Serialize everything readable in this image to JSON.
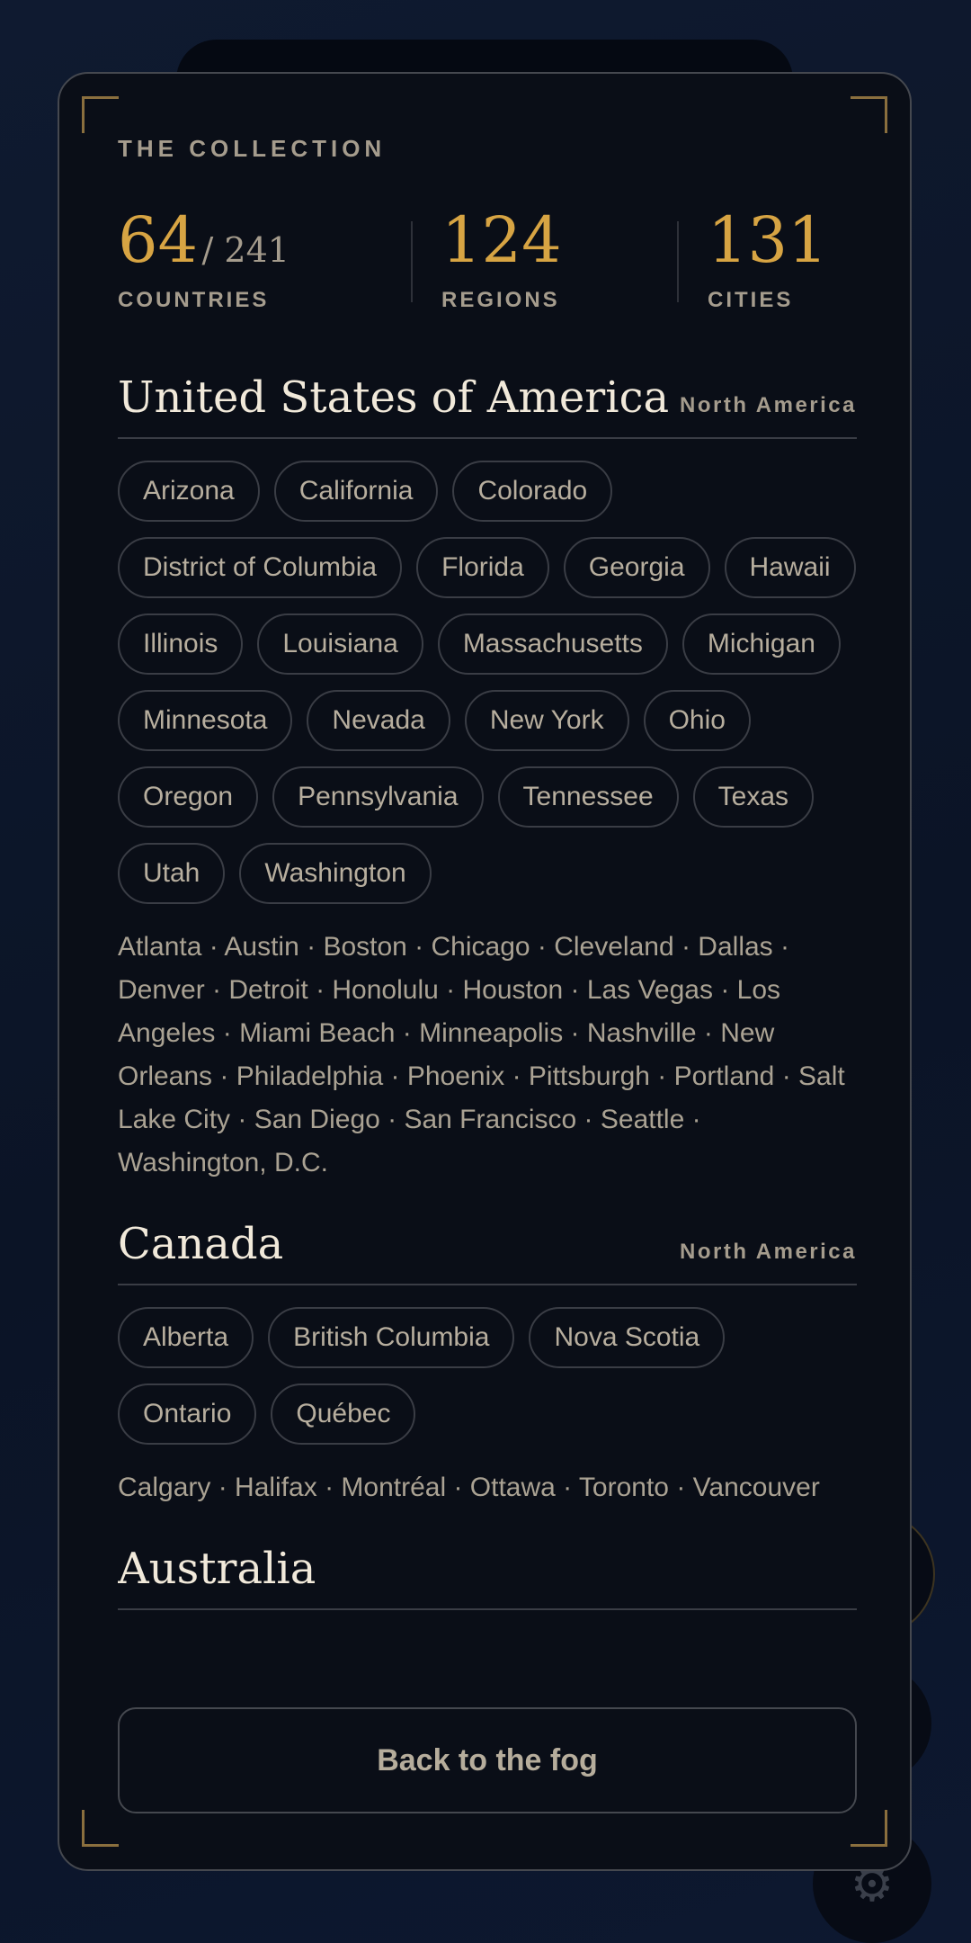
{
  "collection": {
    "title": "THE COLLECTION",
    "stats": {
      "countries": {
        "value": "64",
        "total": "/ 241",
        "label": "COUNTRIES"
      },
      "regions": {
        "value": "124",
        "label": "REGIONS"
      },
      "cities": {
        "value": "131",
        "label": "CITIES"
      }
    }
  },
  "countries": [
    {
      "name": "United States of America",
      "continent": "North America",
      "regions": [
        "Arizona",
        "California",
        "Colorado",
        "District of Columbia",
        "Florida",
        "Georgia",
        "Hawaii",
        "Illinois",
        "Louisiana",
        "Massachusetts",
        "Michigan",
        "Minnesota",
        "Nevada",
        "New York",
        "Ohio",
        "Oregon",
        "Pennsylvania",
        "Tennessee",
        "Texas",
        "Utah",
        "Washington"
      ],
      "cities": "Atlanta · Austin · Boston · Chicago · Cleveland · Dallas · Denver · Detroit · Honolulu · Houston · Las Vegas · Los Angeles · Miami Beach · Minneapolis · Nashville · New Orleans · Philadelphia · Phoenix · Pittsburgh · Portland · Salt Lake City · San Diego · San Francisco · Seattle · Washington, D.C."
    },
    {
      "name": "Canada",
      "continent": "North America",
      "regions": [
        "Alberta",
        "British Columbia",
        "Nova Scotia",
        "Ontario",
        "Québec"
      ],
      "cities": "Calgary · Halifax · Montréal · Ottawa · Toronto · Vancouver"
    },
    {
      "name": "Australia",
      "continent": "",
      "regions": [],
      "cities": ""
    }
  ],
  "back_button": {
    "label": "Back to the fog"
  },
  "icons": {
    "settings": "gear-icon"
  },
  "colors": {
    "accent": "#d7a443",
    "background": "#0b1426",
    "card": "#0a0e17"
  }
}
